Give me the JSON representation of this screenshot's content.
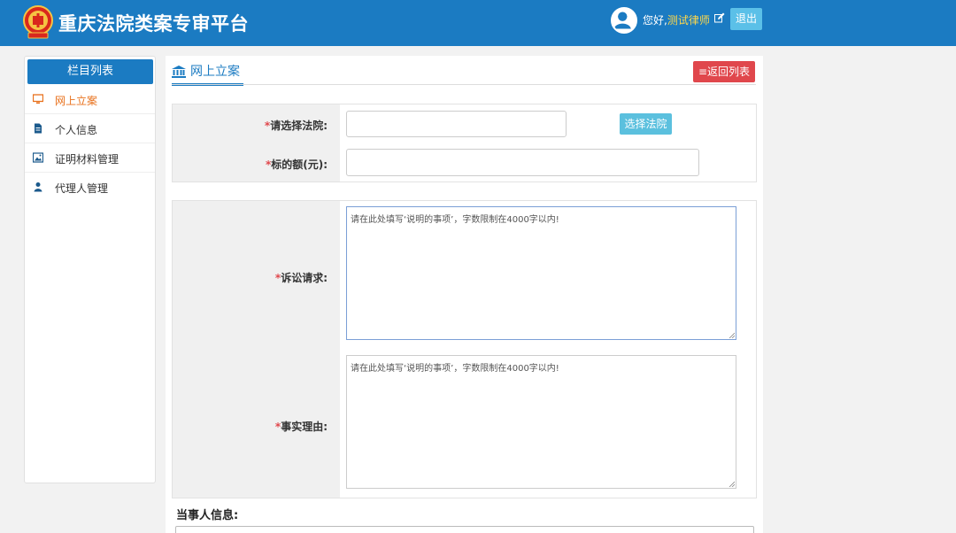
{
  "header": {
    "title": "重庆法院类案专审平台",
    "greeting": "您好,",
    "username": "测试律师",
    "logout_label": "退出",
    "brand_color": "#1b7bc2"
  },
  "sidebar": {
    "heading": "栏目列表",
    "items": [
      {
        "label": "网上立案",
        "icon": "monitor-icon",
        "active": true
      },
      {
        "label": "个人信息",
        "icon": "document-icon",
        "active": false
      },
      {
        "label": "证明材料管理",
        "icon": "image-icon",
        "active": false
      },
      {
        "label": "代理人管理",
        "icon": "user-icon",
        "active": false
      }
    ]
  },
  "main": {
    "tab_title": "网上立案",
    "back_label": "≡返回列表",
    "fields": {
      "court_label": "请选择法院:",
      "court_value": "",
      "choose_court_label": "选择法院",
      "amount_label": "标的额(元):",
      "amount_value": "",
      "claims_label": "诉讼请求:",
      "claims_placeholder": "请在此处填写‘说明的事项’，字数限制在4000字以内!",
      "facts_label": "事实理由:",
      "facts_placeholder": "请在此处填写‘说明的事项’，字数限制在4000字以内!"
    },
    "required_mark": "*",
    "party_section_title": "当事人信息:"
  }
}
